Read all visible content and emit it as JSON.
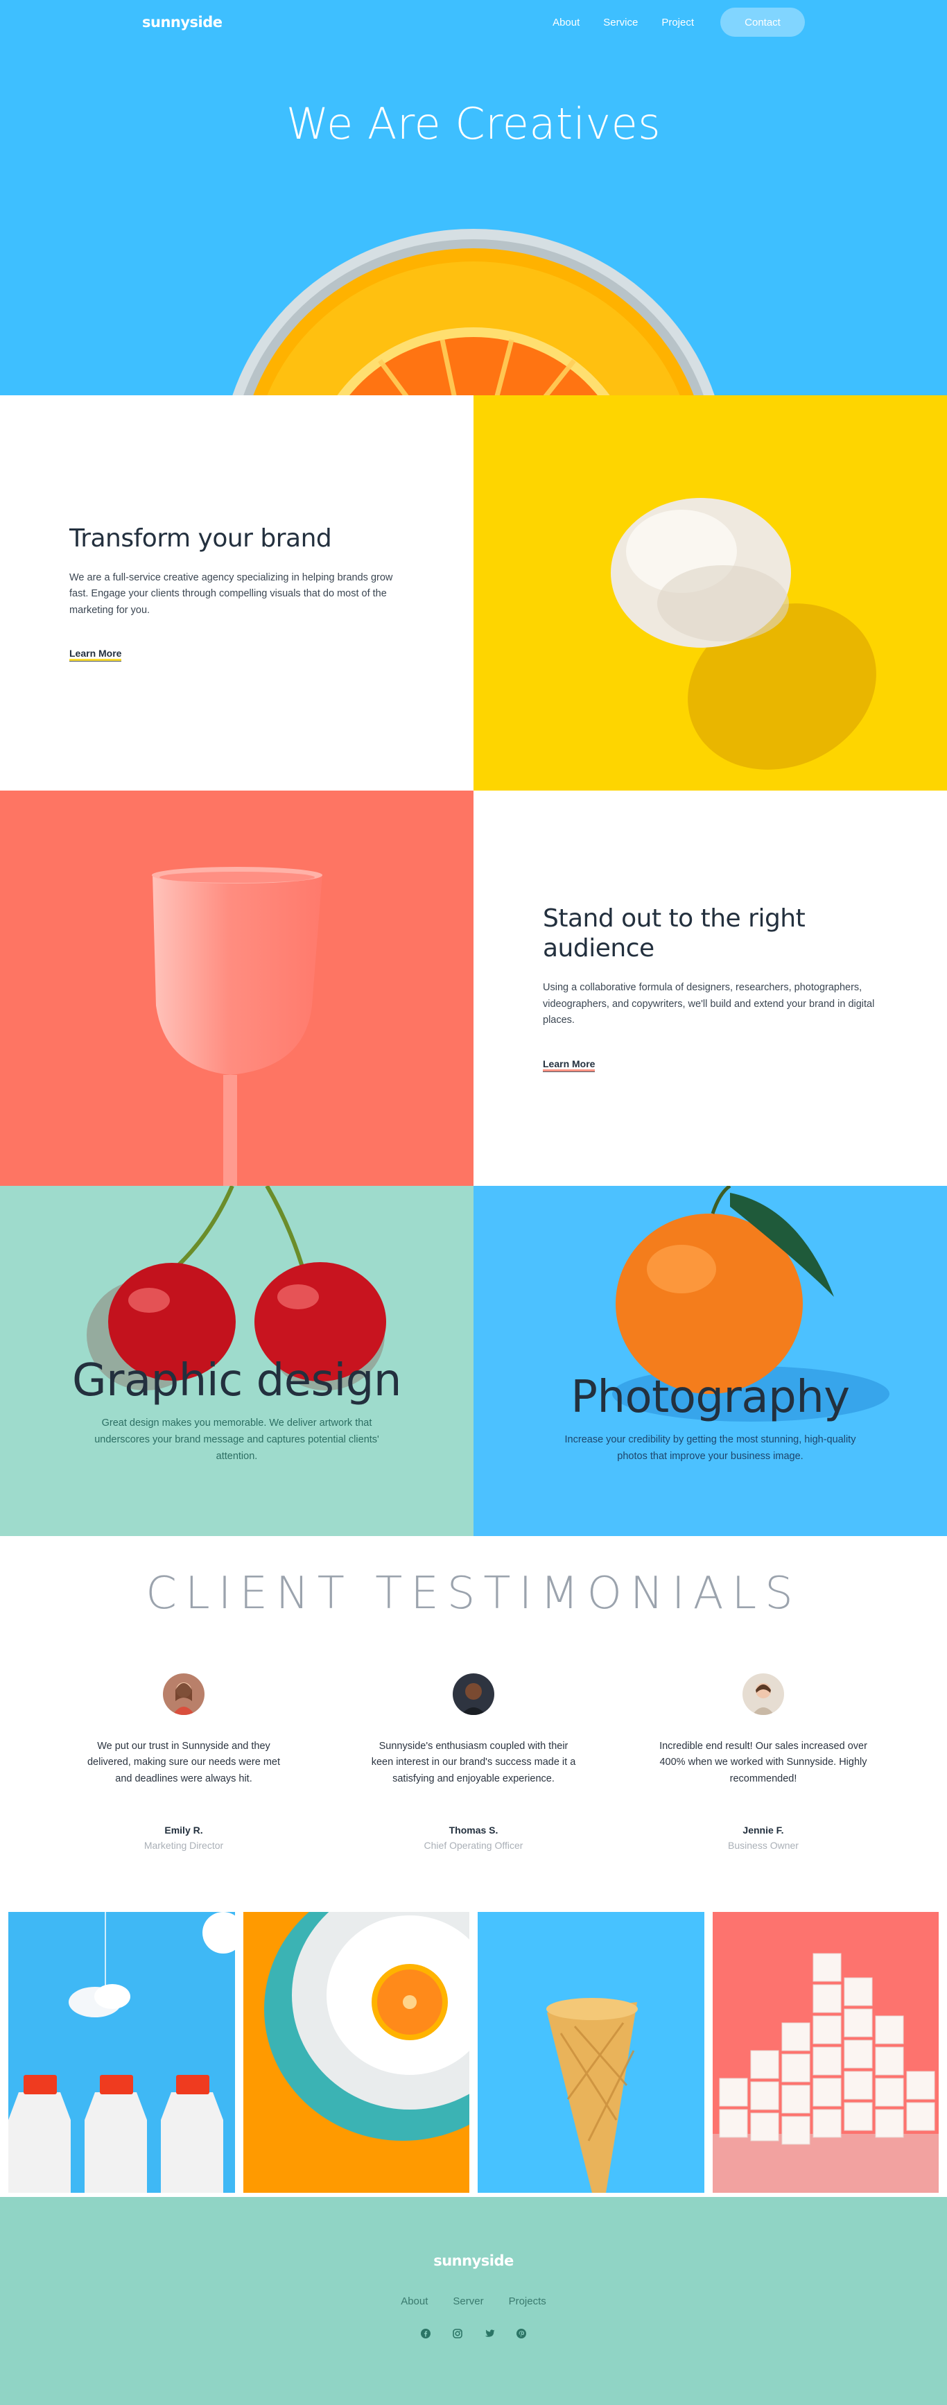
{
  "header": {
    "logo": "sunnyside",
    "nav": {
      "about": "About",
      "service": "Service",
      "project": "Project",
      "contact": "Contact"
    },
    "hero_title": "We Are Creatives"
  },
  "transform": {
    "title": "Transform your brand",
    "text": "We are a full-service creative agency specializing in helping brands grow fast. Engage your clients through compelling visuals that do most of the marketing for you.",
    "link": "Learn More"
  },
  "standout": {
    "title": "Stand out to the right audience",
    "text": "Using a collaborative formula of designers, researchers, photographers, videographers, and copywriters, we'll build and extend your brand in digital places.",
    "link": "Learn More"
  },
  "services": {
    "graphic": {
      "title": "Graphic design",
      "text": "Great design makes you memorable. We deliver artwork that underscores your brand message and captures potential clients' attention."
    },
    "photo": {
      "title": "Photography",
      "text": "Increase your credibility by getting the most stunning, high-quality photos that improve your business image."
    }
  },
  "testimonials": {
    "heading": "CLIENT TESTIMONIALS",
    "items": [
      {
        "quote": "We put our trust in Sunnyside and they delivered, making sure our needs were met and deadlines were always hit.",
        "name": "Emily R.",
        "role": "Marketing Director"
      },
      {
        "quote": "Sunnyside's enthusiasm coupled with their keen interest in our brand's success made it a satisfying and enjoyable experience.",
        "name": "Thomas S.",
        "role": "Chief Operating Officer"
      },
      {
        "quote": "Incredible end result! Our sales increased over 400% when we worked with Sunnyside. Highly recommended!",
        "name": "Jennie F.",
        "role": "Business Owner"
      }
    ]
  },
  "footer": {
    "logo": "sunnyside",
    "links": {
      "about": "About",
      "server": "Server",
      "projects": "Projects"
    },
    "social_icons": [
      "facebook-icon",
      "instagram-icon",
      "twitter-icon",
      "pinterest-icon"
    ]
  },
  "colors": {
    "hero_blue": "#3ebfff",
    "yellow": "#fed500",
    "coral": "#fe7865",
    "mint": "#90d4c5",
    "dark_text": "#23303e"
  }
}
